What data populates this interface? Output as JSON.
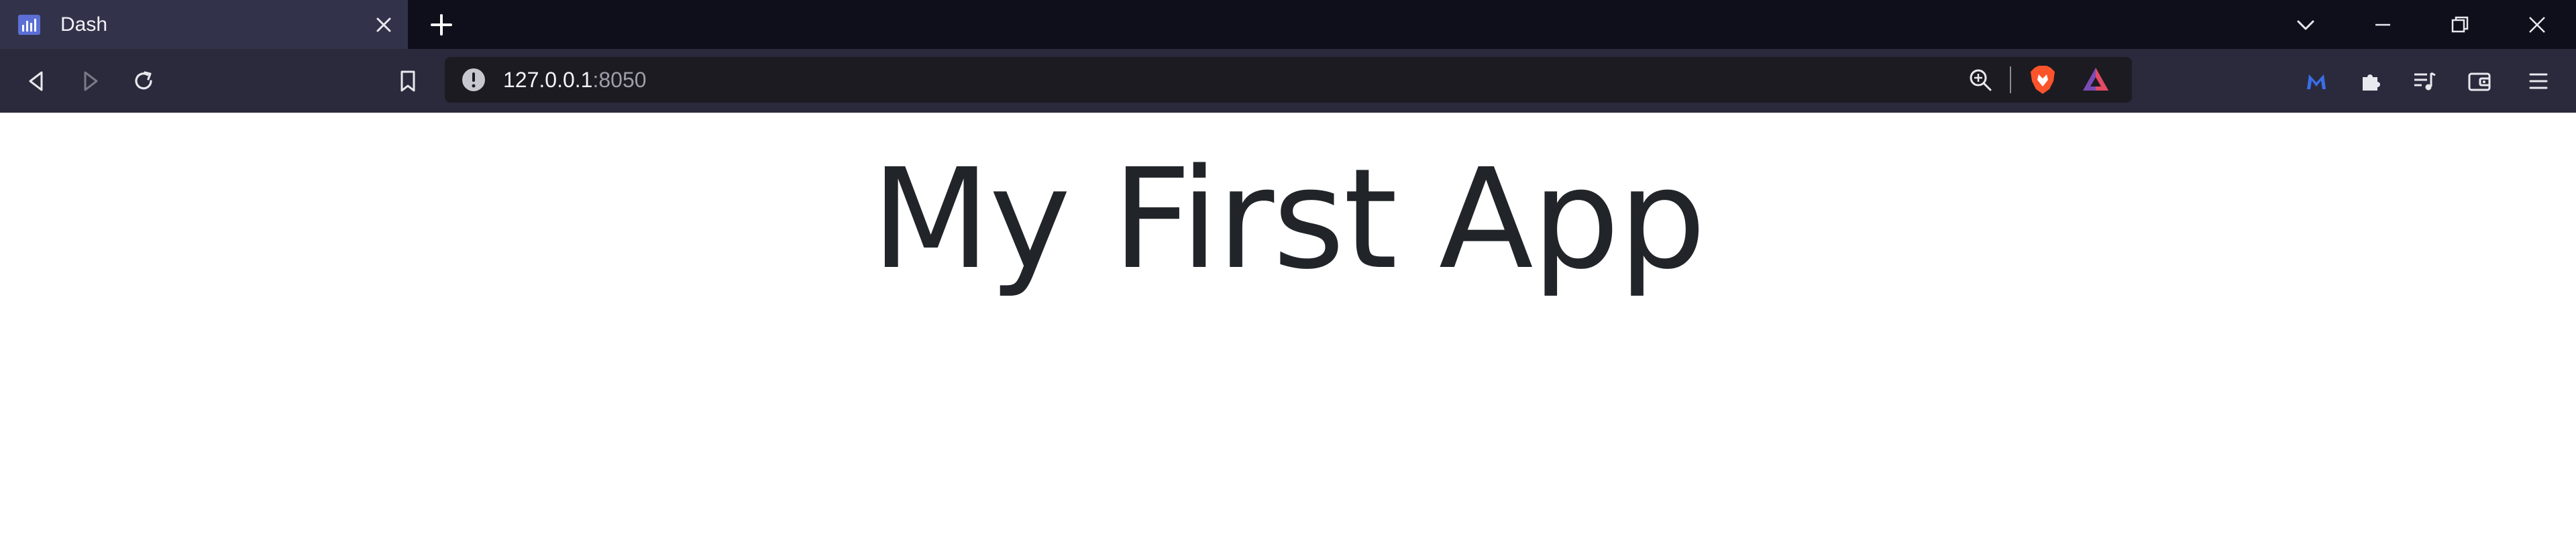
{
  "tab": {
    "title": "Dash",
    "favicon": "dash-chart-icon"
  },
  "address_bar": {
    "host": "127.0.0.1",
    "port": ":8050"
  },
  "page": {
    "heading": "My First App"
  },
  "icons": {
    "tab_close": "close-icon",
    "new_tab": "plus-icon",
    "tab_list": "chevron-down-icon",
    "minimize": "minimize-icon",
    "restore": "restore-icon",
    "close_window": "close-icon",
    "back": "back-icon",
    "forward": "forward-icon",
    "reload": "reload-icon",
    "bookmark": "bookmark-icon",
    "site_info": "info-icon",
    "zoom": "zoom-in-icon",
    "brave_shields": "brave-shield-icon",
    "brave_rewards": "brave-rewards-icon",
    "malwarebytes": "malwarebytes-icon",
    "extensions": "puzzle-icon",
    "media": "playlist-icon",
    "wallet": "wallet-icon",
    "menu": "hamburger-icon"
  },
  "colors": {
    "tabstrip_bg": "#0f0f1c",
    "active_tab_bg": "#32334a",
    "toolbar_bg": "#2b2a3c",
    "urlbar_bg": "#1c1b22",
    "heading_color": "#212529"
  }
}
